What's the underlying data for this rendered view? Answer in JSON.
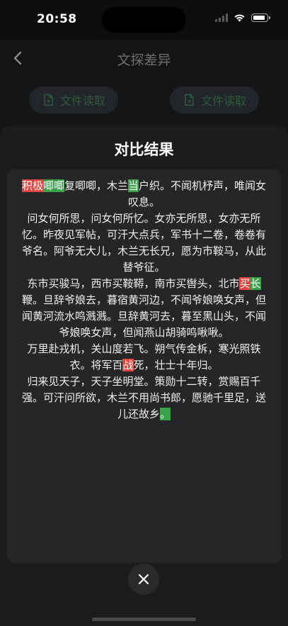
{
  "status": {
    "time": "20:58"
  },
  "nav": {
    "title": "文探差异"
  },
  "toolbar": {
    "read_left": "文件读取",
    "read_right": "文件读取"
  },
  "sheet": {
    "title": "对比结果"
  },
  "result": {
    "paragraphs": [
      [
        {
          "t": "积极",
          "k": "del"
        },
        {
          "t": "唧唧",
          "k": "ins"
        },
        {
          "t": "复唧唧，木兰",
          "k": ""
        },
        {
          "t": "当",
          "k": "ins"
        },
        {
          "t": "户织。不闻机杼声，唯闻女叹息。",
          "k": ""
        }
      ],
      [
        {
          "t": "问女何所思，问女何所忆。女亦无所思，女亦无所忆。昨夜见军帖，可汗大点兵，军书十二卷，卷卷有爷名。阿爷无大儿，木兰无长兄，愿为市鞍马，从此替爷征。",
          "k": ""
        }
      ],
      [
        {
          "t": "东市买骏马，西市买鞍鞯，南市买辔头，北市",
          "k": ""
        },
        {
          "t": "买",
          "k": "del"
        },
        {
          "t": "长",
          "k": "ins"
        },
        {
          "t": "鞭。旦辞爷娘去，暮宿黄河边，不闻爷娘唤女声，但闻黄河流水鸣溅溅。旦辞黄河去，暮至黑山头，不闻爷娘唤女声，但闻燕山胡骑鸣啾啾。",
          "k": ""
        }
      ],
      [
        {
          "t": "万里赴戎机，关山度若飞。朔气传金柝，寒光照铁衣。将军百",
          "k": ""
        },
        {
          "t": "战",
          "k": "del"
        },
        {
          "t": "死，壮士十年归。",
          "k": ""
        }
      ],
      [
        {
          "t": "归来见天子，天子坐明堂。策勋十二转，赏赐百千强。可汗问所欲，木兰不用尚书郎，愿驰千里足，送儿还故乡",
          "k": ""
        },
        {
          "t": "。",
          "k": "ins"
        }
      ]
    ]
  },
  "colors": {
    "deleted": "#e0443e",
    "inserted": "#3aa14a",
    "sheet_bg": "#1c1c1e",
    "card_bg": "#262628"
  },
  "icons": {
    "back": "chevron-left-icon",
    "file": "file-read-icon",
    "close": "close-icon",
    "wifi": "wifi-icon",
    "battery": "battery-icon",
    "signal": "signal-icon"
  }
}
